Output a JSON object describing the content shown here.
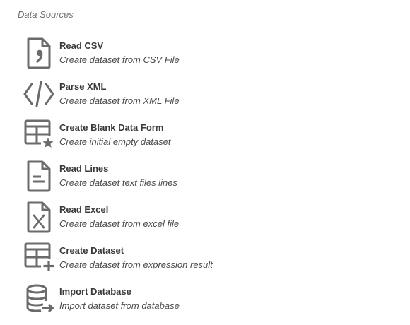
{
  "section": {
    "title": "Data Sources"
  },
  "icon_color": "#6b6b6b",
  "items": [
    {
      "title": "Read CSV",
      "description": "Create dataset from CSV File",
      "icon": "csv-file-icon"
    },
    {
      "title": "Parse XML",
      "description": "Create dataset from XML File",
      "icon": "code-xml-icon"
    },
    {
      "title": "Create Blank Data Form",
      "description": "Create initial empty dataset",
      "icon": "table-star-icon"
    },
    {
      "title": "Read Lines",
      "description": "Create dataset text files lines",
      "icon": "text-file-icon"
    },
    {
      "title": "Read Excel",
      "description": "Create dataset from excel file",
      "icon": "excel-file-icon"
    },
    {
      "title": "Create Dataset",
      "description": "Create dataset from expression result",
      "icon": "table-plus-icon"
    },
    {
      "title": "Import Database",
      "description": "Import dataset from database",
      "icon": "database-import-icon"
    }
  ]
}
